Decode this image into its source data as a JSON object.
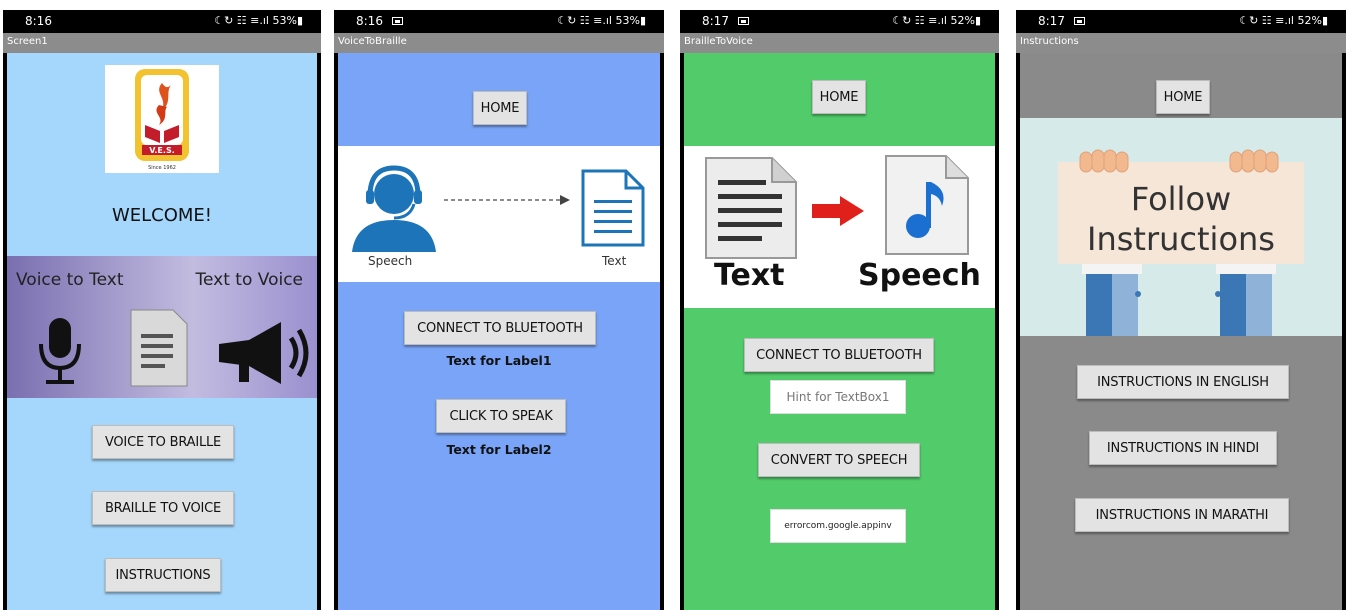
{
  "colors": {
    "screen1_bg": "#a5d6fb",
    "voice_braille_bg": "#79a4f7",
    "braille_voice_bg": "#52cc6a",
    "instructions_bg": "#8a8a8a",
    "titlebar_bg": "#8c8c8c",
    "button_bg": "#e3e3e3"
  },
  "phones": {
    "screen1": {
      "status": {
        "time": "8:16",
        "indicators": "☾↻ ☷ ≡.ıl 53%▮"
      },
      "title": "Screen1",
      "logo_text": "V.E.S.",
      "logo_since": "Since 1962",
      "welcome": "WELCOME!",
      "banner_left": "Voice to Text",
      "banner_right": "Text to Voice",
      "buttons": [
        "VOICE TO BRAILLE",
        "BRAILLE TO VOICE",
        "INSTRUCTIONS"
      ]
    },
    "voice_to_braille": {
      "status": {
        "time": "8:16",
        "indicators": "☾↻ ☷ ≡.ıl 53%▮"
      },
      "title": "VoiceToBraille",
      "home": "HOME",
      "img_left": "Speech",
      "img_right": "Text",
      "connect": "CONNECT TO BLUETOOTH",
      "label1": "Text for Label1",
      "speak": "CLICK TO SPEAK",
      "label2": "Text for Label2"
    },
    "braille_to_voice": {
      "status": {
        "time": "8:17",
        "indicators": "☾↻ ☷ ≡.ıl 52%▮"
      },
      "title": "BrailleToVoice",
      "home": "HOME",
      "img_left": "Text",
      "img_right": "Speech",
      "connect": "CONNECT TO BLUETOOTH",
      "hint": "Hint for TextBox1",
      "convert": "CONVERT TO SPEECH",
      "error": "errorcom.google.appinv"
    },
    "instructions": {
      "status": {
        "time": "8:17",
        "indicators": "☾↻ ☷ ≡.ıl 52%▮"
      },
      "title": "Instructions",
      "home": "HOME",
      "banner_line1": "Follow",
      "banner_line2": "Instructions",
      "buttons": [
        "INSTRUCTIONS IN ENGLISH",
        "INSTRUCTIONS IN HINDI",
        "INSTRUCTIONS IN MARATHI"
      ]
    }
  }
}
